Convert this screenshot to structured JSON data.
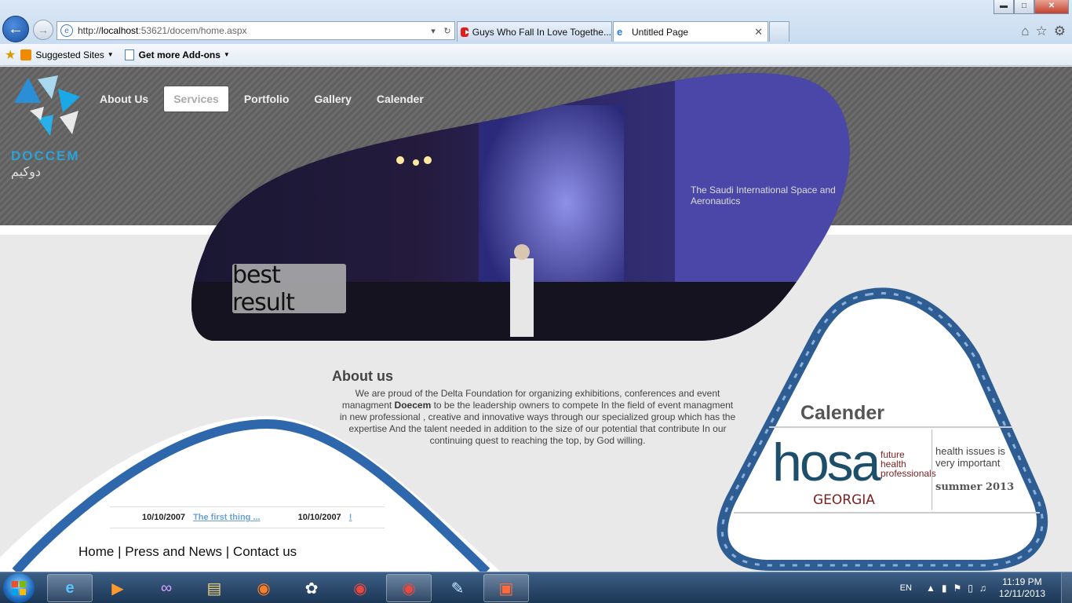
{
  "browser": {
    "url_prefix": "http://",
    "url_host": "localhost",
    "url_rest": ":53621/docem/home.aspx",
    "tabs": [
      {
        "title": "Guys Who Fall In Love Togethe..."
      },
      {
        "title": "Untitled Page"
      }
    ],
    "favorites": {
      "suggested": "Suggested Sites",
      "addons": "Get more Add-ons"
    }
  },
  "site": {
    "logo_text": "DOCCEM",
    "logo_arabic": "دوكيم",
    "menu": [
      {
        "label": "About Us"
      },
      {
        "label": "Services"
      },
      {
        "label": "Portfolio"
      },
      {
        "label": "Gallery"
      },
      {
        "label": "Calender"
      }
    ],
    "hero_caption": "best result",
    "hero_screen_text": "The Saudi International Space and Aeronautics",
    "about_title": "About us",
    "about_text_1": "We are proud of the Delta Foundation for organizing exhibitions, conferences and event managment ",
    "about_bold": "Doecem",
    "about_text_2": " to be the leadership owners to compete In the field of event managment in new professional , creative and innovative ways through our specialized group which has the expertise And the talent needed in addition to the size of our potential that contribute In our continuing quest to reaching the top, by God willing.",
    "news": [
      {
        "date": "10/10/2007",
        "title": "The first thing ..."
      },
      {
        "date": "10/10/2007",
        "title": "!"
      }
    ],
    "footer": {
      "home": "Home",
      "press": "Press and News",
      "contact": "Contact us",
      "sep": "|"
    },
    "calendar": {
      "title": "Calender",
      "logo_word": "hosa",
      "logo_sub": [
        "future",
        "health",
        "professionals"
      ],
      "logo_state": "GEORGIA",
      "desc_line1": "health issues is",
      "desc_line2": "very important",
      "date": "summer 2013"
    }
  },
  "taskbar": {
    "lang": "EN",
    "time": "11:19 PM",
    "date": "12/11/2013"
  }
}
